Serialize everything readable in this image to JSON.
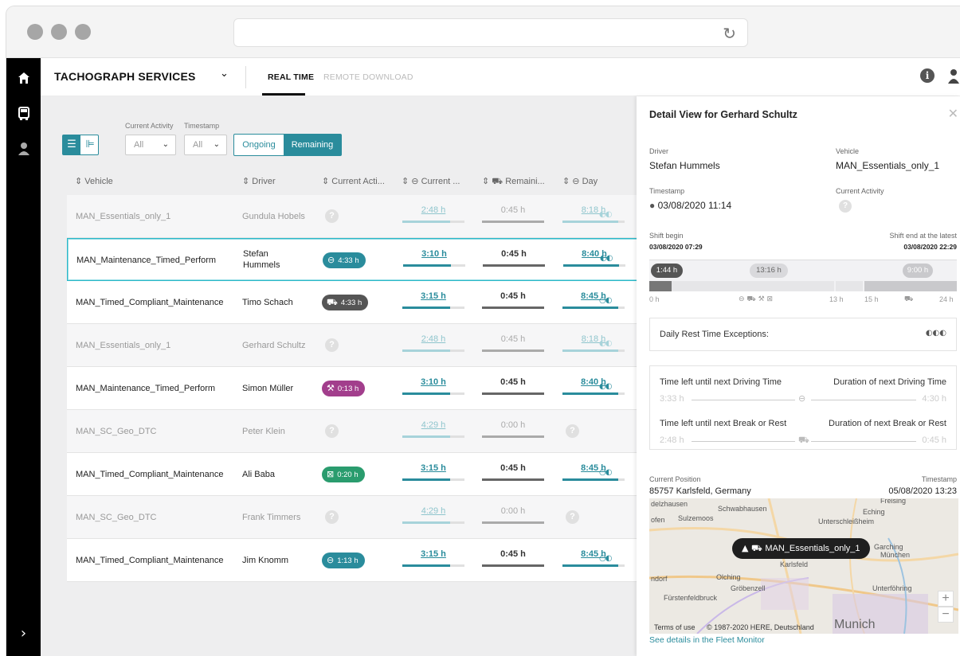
{
  "app": {
    "title": "TACHOGRAPH SERVICES",
    "tabs": [
      "REAL TIME",
      "REMOTE DOWNLOAD"
    ]
  },
  "filters": {
    "current_activity_label": "Current Activity",
    "timestamp_label": "Timestamp",
    "current_activity_value": "All",
    "timestamp_value": "All",
    "mode_ongoing": "Ongoing",
    "mode_remaining": "Remaining"
  },
  "table": {
    "headers": [
      "Vehicle",
      "Driver",
      "Current Acti...",
      "Current ...",
      "Remaini...",
      "Day"
    ],
    "rows": [
      {
        "vehicle": "MAN_Essentials_only_1",
        "driver": "Gundula Hobels",
        "active": false,
        "activity": "",
        "cur": "2:48 h",
        "rem": "0:45 h",
        "day": "8:18 h"
      },
      {
        "vehicle": "MAN_Maintenance_Timed_Perform",
        "driver": "Stefan Hummels",
        "active": true,
        "selected": true,
        "activity": "4:33 h",
        "cur": "3:10 h",
        "rem": "0:45 h",
        "day": "8:40 h"
      },
      {
        "vehicle": "MAN_Timed_Compliant_Maintenance",
        "driver": "Timo Schach",
        "active": true,
        "activity": "4:33 h",
        "cur": "3:15 h",
        "rem": "0:45 h",
        "day": "8:45 h"
      },
      {
        "vehicle": "MAN_Essentials_only_1",
        "driver": "Gerhard Schultz",
        "active": false,
        "activity": "",
        "cur": "2:48 h",
        "rem": "0:45 h",
        "day": "8:18 h"
      },
      {
        "vehicle": "MAN_Maintenance_Timed_Perform",
        "driver": "Simon Müller",
        "active": true,
        "activity": "0:13 h",
        "cur": "3:10 h",
        "rem": "0:45 h",
        "day": "8:40 h"
      },
      {
        "vehicle": "MAN_SC_Geo_DTC",
        "driver": "Peter Klein",
        "active": false,
        "activity": "",
        "cur": "4:29 h",
        "rem": "0:00 h",
        "day": ""
      },
      {
        "vehicle": "MAN_Timed_Compliant_Maintenance",
        "driver": "Ali Baba",
        "active": true,
        "activity": "0:20 h",
        "cur": "3:15 h",
        "rem": "0:45 h",
        "day": "8:45 h"
      },
      {
        "vehicle": "MAN_SC_Geo_DTC",
        "driver": "Frank Timmers",
        "active": false,
        "activity": "",
        "cur": "4:29 h",
        "rem": "0:00 h",
        "day": ""
      },
      {
        "vehicle": "MAN_Timed_Compliant_Maintenance",
        "driver": "Jim Knomm",
        "active": true,
        "activity": "1:13 h",
        "cur": "3:15 h",
        "rem": "0:45 h",
        "day": "8:45 h"
      }
    ]
  },
  "detail": {
    "title": "Detail View for Gerhard Schultz",
    "driver_label": "Driver",
    "driver": "Stefan Hummels",
    "vehicle_label": "Vehicle",
    "vehicle": "MAN_Essentials_only_1",
    "timestamp_label": "Timestamp",
    "timestamp": "03/08/2020 11:14",
    "current_activity_label": "Current Activity",
    "shift_begin_label": "Shift begin",
    "shift_begin": "03/08/2020 07:29",
    "shift_end_label": "Shift end at the latest",
    "shift_end": "03/08/2020 22:29",
    "bar_pills": [
      "1:44 h",
      "13:16 h",
      "9:00 h"
    ],
    "scale": [
      "0 h",
      "13 h",
      "15 h",
      "24 h"
    ],
    "daily_rest_label": "Daily Rest Time Exceptions:",
    "time_left_driving_label": "Time left until next Driving Time",
    "duration_driving_label": "Duration of next Driving Time",
    "time_left_driving": "3:33 h",
    "duration_driving": "4:30 h",
    "time_left_break_label": "Time left until next Break or Rest",
    "duration_break_label": "Duration of next Break or Rest",
    "time_left_break": "2:48 h",
    "duration_break": "0:45 h",
    "position_label": "Current Position",
    "position": "85757 Karlsfeld, Germany",
    "position_ts_label": "Timestamp",
    "position_ts": "05/08/2020 13:23",
    "map_pin": "MAN_Essentials_only_1",
    "map_labels": [
      "delzhausen",
      "Schwabhausen",
      "Freising",
      "ofen",
      "Sulzemoos",
      "Eching",
      "Unterschleißheim",
      "Karlsfeld",
      "Garching",
      "München",
      "ndorf",
      "Olching",
      "Gröbenzell",
      "Unterföhring",
      "Fürstenfeldbruck",
      "Munich"
    ],
    "map_terms": "Terms of use",
    "map_copyright": "© 1987-2020 HERE, Deutschland",
    "fleet_link": "See details in the Fleet Monitor"
  },
  "colors": {
    "accent": "#2a8c9c",
    "pill_steer": "#2a8c9c",
    "pill_rest": "#555555",
    "pill_work": "#a23e8c",
    "pill_avail": "#2a9c6e",
    "sidebar": "#000000"
  },
  "icons": [
    "home-icon",
    "bus-icon",
    "driver-icon",
    "expand-icon",
    "info-icon",
    "user-icon",
    "reload-icon",
    "close-icon"
  ]
}
